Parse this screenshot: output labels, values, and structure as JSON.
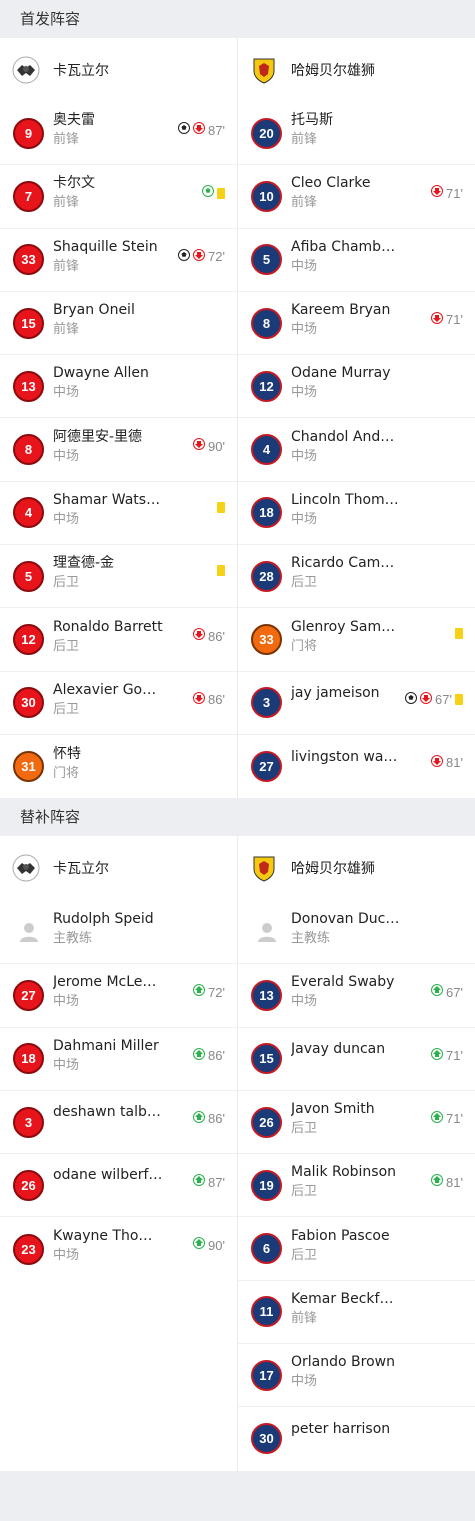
{
  "starting": {
    "title": "首发阵容",
    "home": {
      "name": "卡瓦立尔",
      "players": [
        {
          "num": "9",
          "name": "奥夫雷",
          "pos": "前锋",
          "color": "red",
          "goal": true,
          "sub_out": "87'",
          "ycard": false
        },
        {
          "num": "7",
          "name": "卡尔文",
          "pos": "前锋",
          "color": "red",
          "goal_green": true,
          "ycard": true
        },
        {
          "num": "33",
          "name": "Shaquille Stein",
          "pos": "前锋",
          "color": "red",
          "goal": true,
          "sub_out": "72'"
        },
        {
          "num": "15",
          "name": "Bryan Oneil",
          "pos": "前锋",
          "color": "red"
        },
        {
          "num": "13",
          "name": "Dwayne Allen",
          "pos": "中场",
          "color": "red"
        },
        {
          "num": "8",
          "name": "阿德里安-里德",
          "pos": "中场",
          "color": "red",
          "sub_out": "90'"
        },
        {
          "num": "4",
          "name": "Shamar Watson",
          "pos": "中场",
          "color": "red",
          "ycard": true
        },
        {
          "num": "5",
          "name": "理查德-金",
          "pos": "后卫",
          "color": "red",
          "ycard": true
        },
        {
          "num": "12",
          "name": "Ronaldo Barrett",
          "pos": "后卫",
          "color": "red",
          "sub_out": "86'"
        },
        {
          "num": "30",
          "name": "Alexavier Go…",
          "pos": "后卫",
          "color": "red",
          "sub_out": "86'"
        },
        {
          "num": "31",
          "name": "怀特",
          "pos": "门将",
          "color": "orange"
        }
      ]
    },
    "away": {
      "name": "哈姆贝尔雄狮",
      "players": [
        {
          "num": "20",
          "name": "托马斯",
          "pos": "前锋",
          "color": "navy"
        },
        {
          "num": "10",
          "name": "Cleo Clarke",
          "pos": "前锋",
          "color": "navy",
          "sub_out": "71'"
        },
        {
          "num": "5",
          "name": "Afiba Chambers",
          "pos": "中场",
          "color": "navy"
        },
        {
          "num": "8",
          "name": "Kareem Bryan",
          "pos": "中场",
          "color": "navy",
          "sub_out": "71'"
        },
        {
          "num": "12",
          "name": "Odane Murray",
          "pos": "中场",
          "color": "navy"
        },
        {
          "num": "4",
          "name": "Chandol Ande…",
          "pos": "中场",
          "color": "navy"
        },
        {
          "num": "18",
          "name": "Lincoln Thom…",
          "pos": "中场",
          "color": "navy"
        },
        {
          "num": "28",
          "name": "Ricardo Cam…",
          "pos": "后卫",
          "color": "navy"
        },
        {
          "num": "33",
          "name": "Glenroy Samuel",
          "pos": "门将",
          "color": "orange",
          "ycard": true
        },
        {
          "num": "3",
          "name": "jay jameison",
          "pos": "",
          "color": "navy",
          "goal": true,
          "sub_out": "67'",
          "ycard": true
        },
        {
          "num": "27",
          "name": "livingston wal…",
          "pos": "",
          "color": "navy",
          "sub_out": "81'"
        }
      ]
    }
  },
  "subs": {
    "title": "替补阵容",
    "home": {
      "name": "卡瓦立尔",
      "coach": {
        "name": "Rudolph Speid",
        "role": "主教练"
      },
      "players": [
        {
          "num": "27",
          "name": "Jerome McLe…",
          "pos": "中场",
          "color": "red",
          "sub_in": "72'"
        },
        {
          "num": "18",
          "name": "Dahmani Miller",
          "pos": "中场",
          "color": "red",
          "sub_in": "86'"
        },
        {
          "num": "3",
          "name": "deshawn talbert",
          "pos": "",
          "color": "red",
          "sub_in": "86'"
        },
        {
          "num": "26",
          "name": "odane wilberf…",
          "pos": "",
          "color": "red",
          "sub_in": "87'"
        },
        {
          "num": "23",
          "name": "Kwayne Tho…",
          "pos": "中场",
          "color": "red",
          "sub_in": "90'"
        }
      ]
    },
    "away": {
      "name": "哈姆贝尔雄狮",
      "coach": {
        "name": "Donovan Duckie",
        "role": "主教练"
      },
      "players": [
        {
          "num": "13",
          "name": "Everald Swaby",
          "pos": "中场",
          "color": "navy",
          "sub_in": "67'"
        },
        {
          "num": "15",
          "name": "Javay duncan",
          "pos": "",
          "color": "navy",
          "sub_in": "71'"
        },
        {
          "num": "26",
          "name": "Javon Smith",
          "pos": "后卫",
          "color": "navy",
          "sub_in": "71'"
        },
        {
          "num": "19",
          "name": "Malik Robinson",
          "pos": "后卫",
          "color": "navy",
          "sub_in": "81'"
        },
        {
          "num": "6",
          "name": "Fabion Pascoe",
          "pos": "后卫",
          "color": "navy"
        },
        {
          "num": "11",
          "name": "Kemar Beckf…",
          "pos": "前锋",
          "color": "navy"
        },
        {
          "num": "17",
          "name": "Orlando Brown",
          "pos": "中场",
          "color": "navy"
        },
        {
          "num": "30",
          "name": "peter harrison",
          "pos": "",
          "color": "navy"
        }
      ]
    }
  },
  "colors": {
    "red": "#e8141b",
    "navy": "#1a3a78",
    "orange": "#f26a0f",
    "yellow_card": "#f7d116",
    "sub_in": "#2bb24c",
    "sub_out": "#e8141b"
  }
}
